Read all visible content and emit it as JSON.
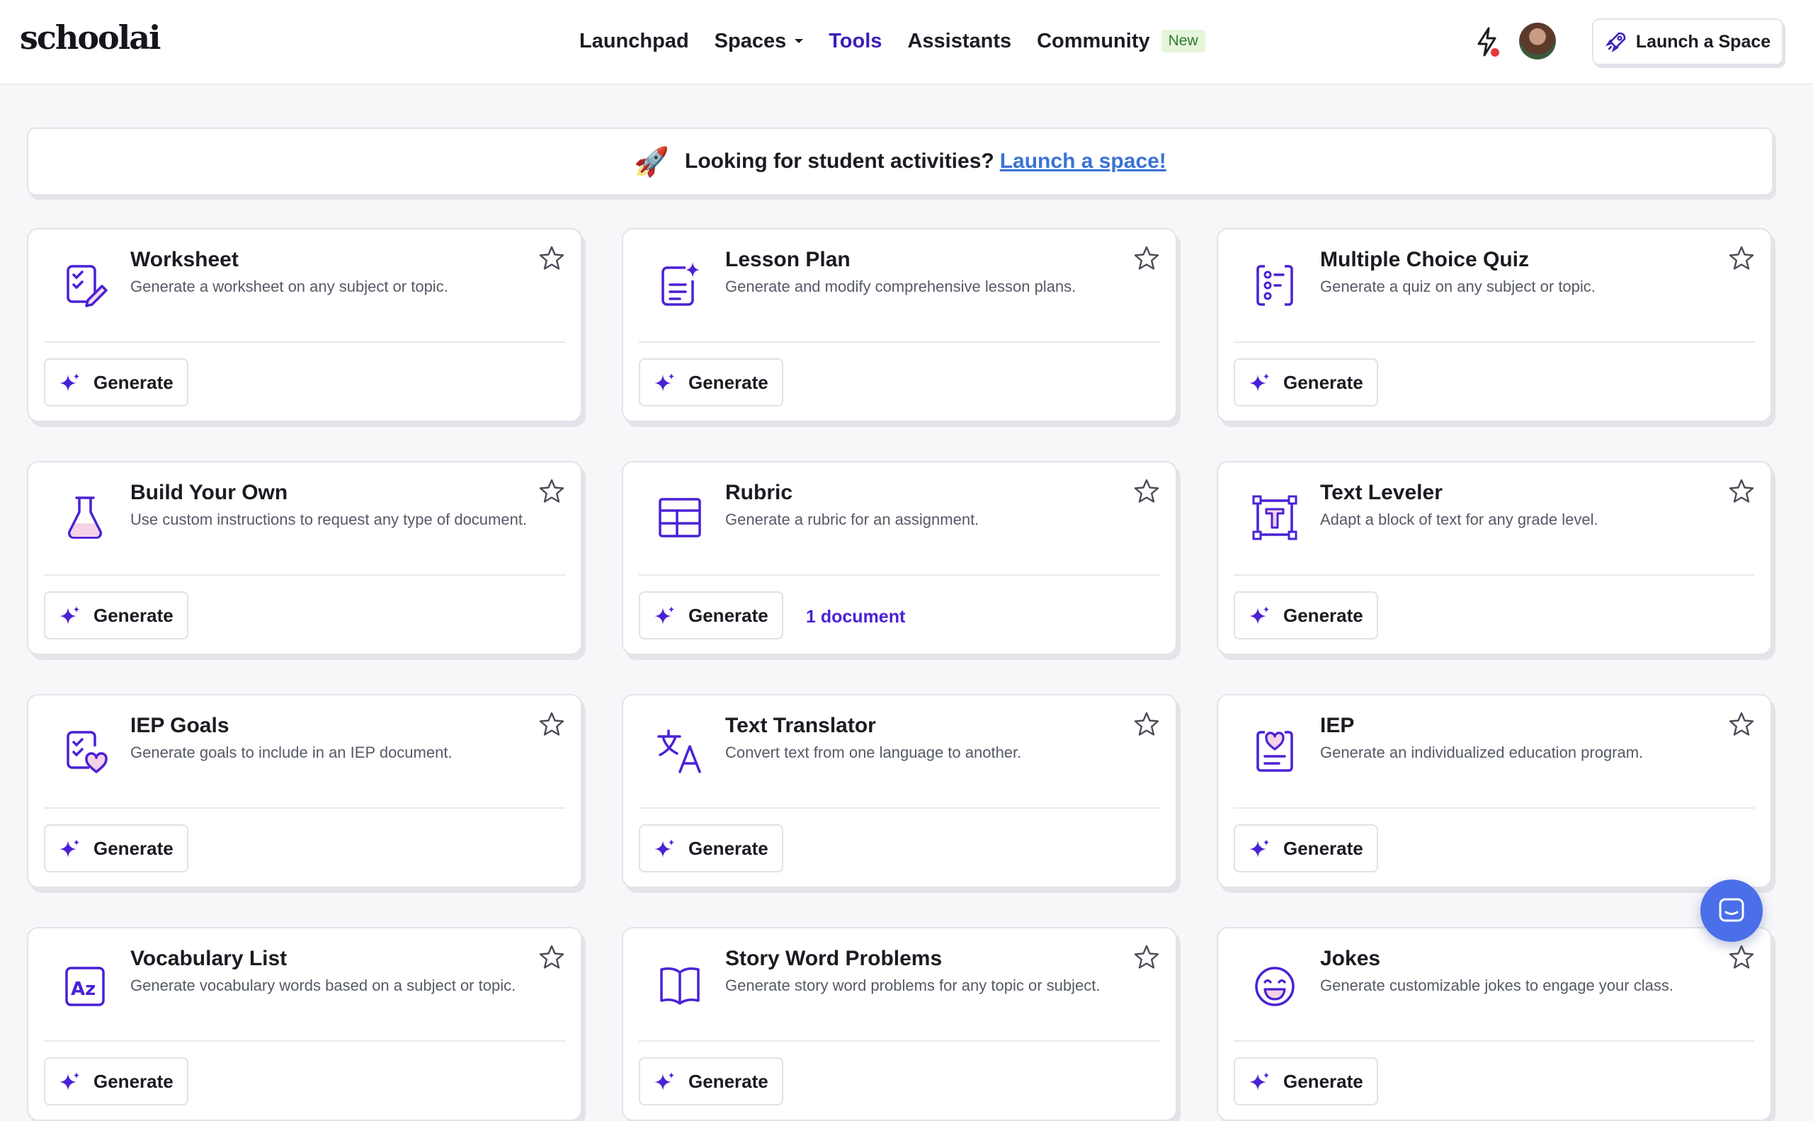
{
  "header": {
    "logo": "schoolai",
    "nav": [
      {
        "label": "Launchpad"
      },
      {
        "label": "Spaces"
      },
      {
        "label": "Tools"
      },
      {
        "label": "Assistants"
      },
      {
        "label": "Community"
      }
    ],
    "community_badge": "New",
    "launch_button": "Launch a Space"
  },
  "banner": {
    "text": "Looking for student activities?",
    "link": "Launch a space!"
  },
  "tools": [
    {
      "title": "Worksheet",
      "desc": "Generate a worksheet on any subject or topic.",
      "button": "Generate",
      "icon": "worksheet-icon"
    },
    {
      "title": "Lesson Plan",
      "desc": "Generate and modify comprehensive lesson plans.",
      "button": "Generate",
      "icon": "lesson-plan-icon"
    },
    {
      "title": "Multiple Choice Quiz",
      "desc": "Generate a quiz on any subject or topic.",
      "button": "Generate",
      "icon": "quiz-icon"
    },
    {
      "title": "Build Your Own",
      "desc": "Use custom instructions to request any type of document.",
      "button": "Generate",
      "icon": "flask-icon"
    },
    {
      "title": "Rubric",
      "desc": "Generate a rubric for an assignment.",
      "button": "Generate",
      "doc_count": "1 document",
      "icon": "table-icon"
    },
    {
      "title": "Text Leveler",
      "desc": "Adapt a block of text for any grade level.",
      "button": "Generate",
      "icon": "text-leveler-icon"
    },
    {
      "title": "IEP Goals",
      "desc": "Generate goals to include in an IEP document.",
      "button": "Generate",
      "icon": "iep-goals-icon"
    },
    {
      "title": "Text Translator",
      "desc": "Convert text from one language to another.",
      "button": "Generate",
      "icon": "translate-icon"
    },
    {
      "title": "IEP",
      "desc": "Generate an individualized education program.",
      "button": "Generate",
      "icon": "iep-icon"
    },
    {
      "title": "Vocabulary List",
      "desc": "Generate vocabulary words based on a subject or topic.",
      "button": "Generate",
      "icon": "vocabulary-icon"
    },
    {
      "title": "Story Word Problems",
      "desc": "Generate story word problems for any topic or subject.",
      "button": "Generate",
      "icon": "story-book-icon"
    },
    {
      "title": "Jokes",
      "desc": "Generate customizable jokes to engage your class.",
      "button": "Generate",
      "icon": "laugh-icon"
    }
  ],
  "colors": {
    "accent": "#4a21d6",
    "link": "#3b72d6",
    "active_nav": "#3d1fb8",
    "chat": "#4a6fe8"
  }
}
